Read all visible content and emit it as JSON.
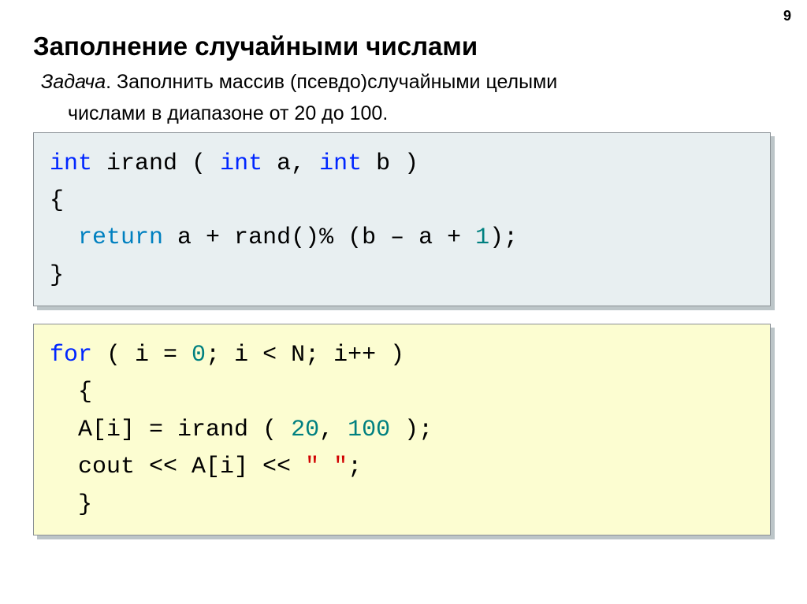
{
  "page_number": "9",
  "title": "Заполнение случайными числами",
  "task": {
    "label": "Задача",
    "line1": ". Заполнить массив (псевдо)случайными целыми",
    "line2": "числами в диапазоне от 20 до 100."
  },
  "code1": {
    "kw_int1": "int",
    "fname": " irand",
    "paren_open": " ( ",
    "kw_int2": "int",
    "arg_a": " a, ",
    "kw_int3": "int",
    "arg_b": " b )",
    "brace_open": "{",
    "indent": "  ",
    "kw_return": "return",
    "expr1": " a + rand()% (b ",
    "minus": "–",
    "expr2": " a + ",
    "one": "1",
    "expr3": ");",
    "brace_close": "}"
  },
  "code2": {
    "kw_for": "for",
    "for_open": " ( i = ",
    "zero": "0",
    "for_cond": "; i < N; i++ )",
    "indent1": "  ",
    "brace_open": "{",
    "line3a": "  A[i] = irand ( ",
    "n20": "20",
    "comma": ", ",
    "n100": "100",
    "line3b": " );",
    "line4a": "  cout << A[i] << ",
    "space_str": "\" \"",
    "line4b": ";",
    "brace_close": "  }"
  }
}
